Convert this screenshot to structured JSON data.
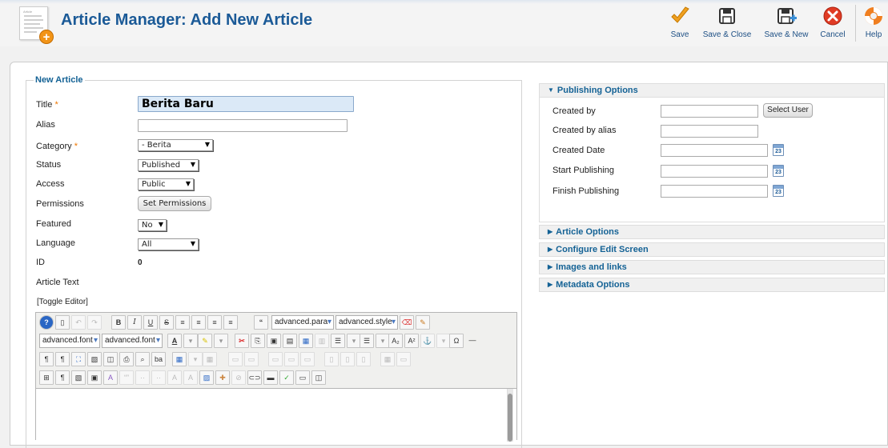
{
  "header": {
    "title": "Article Manager: Add New Article",
    "icon_tiny_text": "Article",
    "buttons": [
      {
        "label": "Save",
        "icon": "checkmark-icon"
      },
      {
        "label": "Save & Close",
        "icon": "save-icon"
      },
      {
        "label": "Save & New",
        "icon": "save-new-icon"
      },
      {
        "label": "Cancel",
        "icon": "cancel-icon"
      },
      {
        "label": "Help",
        "icon": "help-lifebuoy-icon"
      }
    ]
  },
  "form": {
    "legend": "New Article",
    "title_label": "Title",
    "title_value": "Berita Baru",
    "alias_label": "Alias",
    "alias_value": "",
    "category_label": "Category",
    "category_value": "- Berita",
    "status_label": "Status",
    "status_value": "Published",
    "access_label": "Access",
    "access_value": "Public",
    "permissions_label": "Permissions",
    "permissions_button": "Set Permissions",
    "featured_label": "Featured",
    "featured_value": "No",
    "language_label": "Language",
    "language_value": "All",
    "id_label": "ID",
    "id_value": "0",
    "article_text_label": "Article Text",
    "toggle_editor": "[Toggle Editor]",
    "required_marker": "*"
  },
  "editor": {
    "row1_drops": [
      "advanced.para",
      "advanced.style"
    ],
    "row2_drops": [
      "advanced.font",
      "advanced.font"
    ],
    "bold": "B",
    "italic": "I",
    "underline": "U",
    "strike": "S",
    "quote": "“",
    "omega": "Ω"
  },
  "publishing": {
    "heading": "Publishing Options",
    "created_by_label": "Created by",
    "select_user": "Select User",
    "created_by_alias_label": "Created by alias",
    "created_date_label": "Created Date",
    "start_publishing_label": "Start Publishing",
    "finish_publishing_label": "Finish Publishing",
    "calendar_day": "23"
  },
  "panels": [
    {
      "label": "Article Options"
    },
    {
      "label": "Configure Edit Screen"
    },
    {
      "label": "Images and links"
    },
    {
      "label": "Metadata Options"
    }
  ],
  "colors": {
    "title_blue": "#1b5a97",
    "accent_orange": "#f29417",
    "cancel_red": "#e03b24",
    "save_check": "#f0a020"
  }
}
